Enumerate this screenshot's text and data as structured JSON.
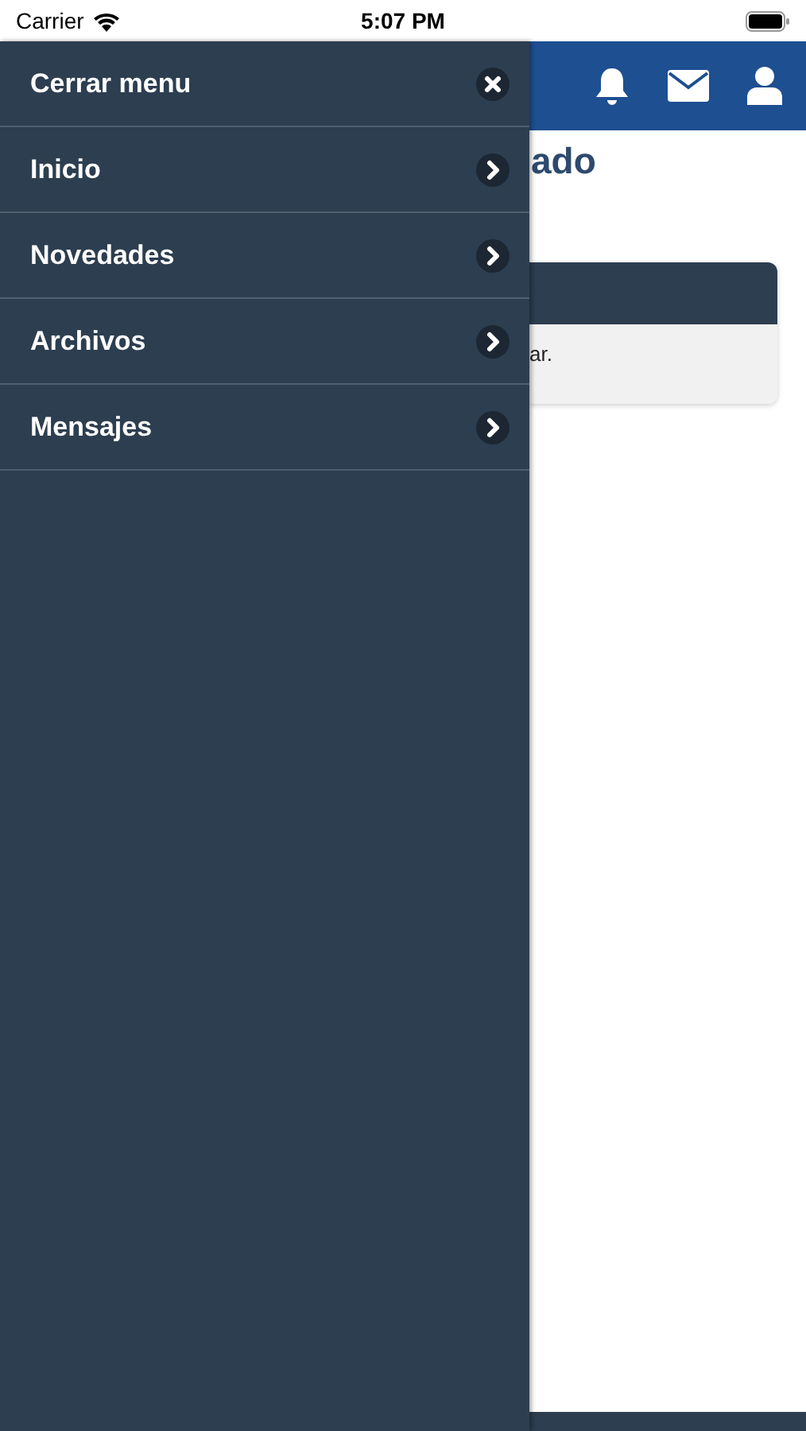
{
  "status_bar": {
    "carrier": "Carrier",
    "time": "5:07 PM"
  },
  "menu": {
    "close_label": "Cerrar menu",
    "items": [
      {
        "label": "Inicio"
      },
      {
        "label": "Novedades"
      },
      {
        "label": "Archivos"
      },
      {
        "label": "Mensajes"
      }
    ]
  },
  "page": {
    "title": "ado",
    "card_text": "ar."
  }
}
